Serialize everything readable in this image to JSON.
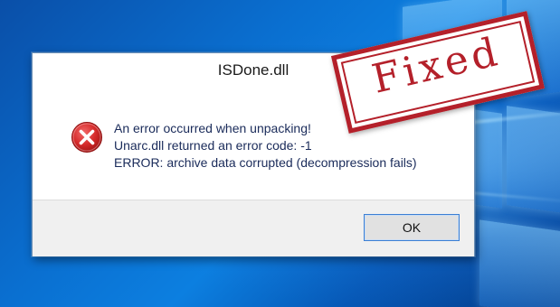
{
  "dialog": {
    "title": "ISDone.dll",
    "icon": "error-icon",
    "message_lines": [
      "An error occurred when unpacking!",
      "Unarc.dll returned an error code: -1",
      "ERROR: archive data corrupted (decompression fails)"
    ],
    "ok_label": "OK"
  },
  "stamp": {
    "text": "Fixed"
  },
  "colors": {
    "error_red": "#d62b2b",
    "stamp_red": "#b4202a",
    "button_focus_border": "#3c7fd4",
    "desktop_blue": "#0a6fd0"
  }
}
